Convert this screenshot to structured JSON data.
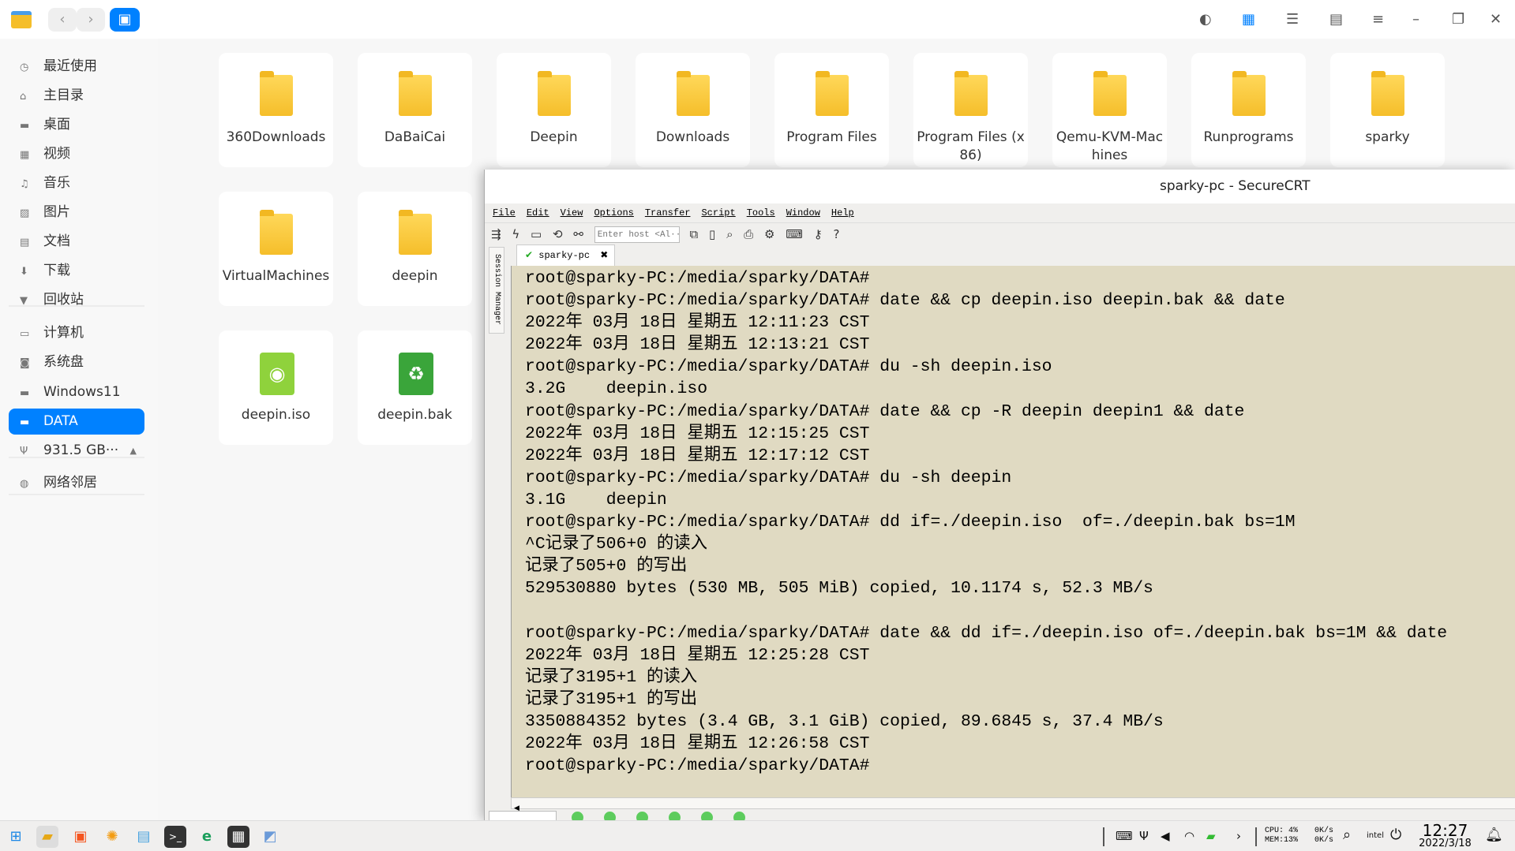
{
  "file_manager": {
    "sidebar": [
      {
        "icon": "clock-icon",
        "glyph": "◷",
        "label": "最近使用"
      },
      {
        "icon": "home-icon",
        "glyph": "⌂",
        "label": "主目录"
      },
      {
        "icon": "desktop-icon",
        "glyph": "▬",
        "label": "桌面"
      },
      {
        "icon": "video-icon",
        "glyph": "▦",
        "label": "视频"
      },
      {
        "icon": "music-icon",
        "glyph": "♫",
        "label": "音乐"
      },
      {
        "icon": "picture-icon",
        "glyph": "▨",
        "label": "图片"
      },
      {
        "icon": "document-icon",
        "glyph": "▤",
        "label": "文档"
      },
      {
        "icon": "download-icon",
        "glyph": "⬇",
        "label": "下载"
      },
      {
        "icon": "trash-icon",
        "glyph": "▼",
        "label": "回收站"
      },
      {
        "icon": "computer-icon",
        "glyph": "▭",
        "label": "计算机"
      },
      {
        "icon": "system-disk-icon",
        "glyph": "◙",
        "label": "系统盘"
      },
      {
        "icon": "drive-icon",
        "glyph": "▬",
        "label": "Windows11"
      },
      {
        "icon": "drive-icon",
        "glyph": "▬",
        "label": "DATA",
        "active": true
      },
      {
        "icon": "usb-icon",
        "glyph": "Ψ",
        "label": "931.5 GB···",
        "eject": "▲"
      },
      {
        "icon": "network-icon",
        "glyph": "◍",
        "label": "网络邻居"
      }
    ],
    "files": [
      {
        "name": "360Downloads",
        "type": "folder"
      },
      {
        "name": "DaBaiCai",
        "type": "folder"
      },
      {
        "name": "Deepin",
        "type": "folder"
      },
      {
        "name": "Downloads",
        "type": "folder"
      },
      {
        "name": "Program Files",
        "type": "folder"
      },
      {
        "name": "Program Files (x86)",
        "type": "folder"
      },
      {
        "name": "Qemu-KVM-Machines",
        "type": "folder"
      },
      {
        "name": "Runprograms",
        "type": "folder"
      },
      {
        "name": "sparky",
        "type": "folder"
      },
      {
        "name": "VirtualMachines",
        "type": "folder"
      },
      {
        "name": "deepin",
        "type": "folder"
      },
      {
        "name": "deepin.iso",
        "type": "iso"
      },
      {
        "name": "deepin.bak",
        "type": "bak"
      }
    ]
  },
  "securecrt": {
    "title": "sparky-pc - SecureCRT",
    "menu": [
      "File",
      "Edit",
      "View",
      "Options",
      "Transfer",
      "Script",
      "Tools",
      "Window",
      "Help"
    ],
    "host_placeholder": "Enter host <Al···",
    "session_manager": "Session Manager",
    "tab": "sparky-pc",
    "terminal": [
      "root@sparky-PC:/media/sparky/DATA#",
      "root@sparky-PC:/media/sparky/DATA# date && cp deepin.iso deepin.bak && date",
      "2022年 03月 18日 星期五 12:11:23 CST",
      "2022年 03月 18日 星期五 12:13:21 CST",
      "root@sparky-PC:/media/sparky/DATA# du -sh deepin.iso",
      "3.2G    deepin.iso",
      "root@sparky-PC:/media/sparky/DATA# date && cp -R deepin deepin1 && date",
      "2022年 03月 18日 星期五 12:15:25 CST",
      "2022年 03月 18日 星期五 12:17:12 CST",
      "root@sparky-PC:/media/sparky/DATA# du -sh deepin",
      "3.1G    deepin",
      "root@sparky-PC:/media/sparky/DATA# dd if=./deepin.iso  of=./deepin.bak bs=1M",
      "^C记录了506+0 的读入",
      "记录了505+0 的写出",
      "529530880 bytes (530 MB, 505 MiB) copied, 10.1174 s, 52.3 MB/s",
      "",
      "root@sparky-PC:/media/sparky/DATA# date && dd if=./deepin.iso of=./deepin.bak bs=1M && date",
      "2022年 03月 18日 星期五 12:25:28 CST",
      "记录了3195+1 的读入",
      "记录了3195+1 的写出",
      "3350884352 bytes (3.4 GB, 3.1 GiB) copied, 89.6845 s, 37.4 MB/s",
      "2022年 03月 18日 星期五 12:26:58 CST",
      "root@sparky-PC:/media/sparky/DATA#"
    ],
    "terminal_bg": "#e0dac2"
  },
  "tray": {
    "cpu": "CPU: 4%",
    "mem": "MEM:13%",
    "up": "0K/s",
    "down": "0K/s",
    "time": "12:27",
    "date": "2022/3/18"
  },
  "colors": {
    "accent": "#0081ff"
  }
}
